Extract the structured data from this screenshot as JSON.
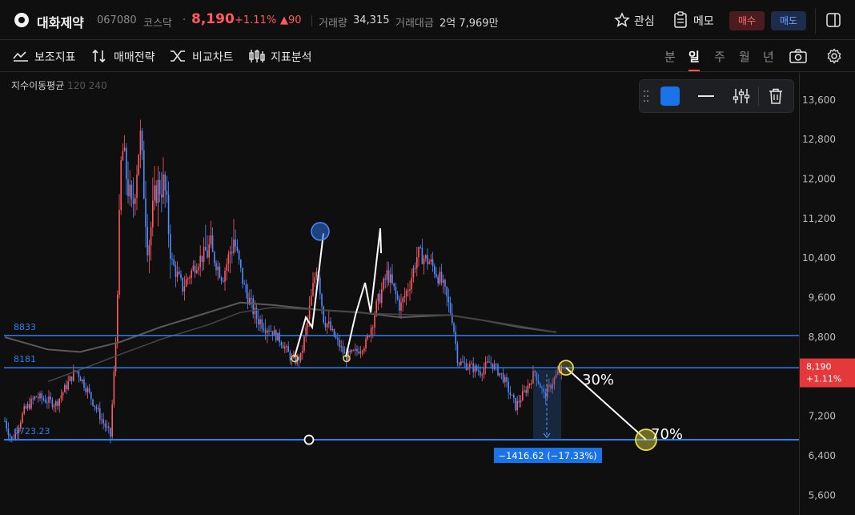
{
  "header": {
    "stock_name": "대화제약",
    "stock_code": "067080",
    "market": "코스닥",
    "separator": "·",
    "price": "8,190",
    "change_pct": "+1.11%",
    "change_amt": "▲90",
    "volume_label": "거래량",
    "volume_value": "34,315",
    "amount_label": "거래대금",
    "amount_value": "2억 7,969만",
    "favorite_label": "관심",
    "memo_label": "메모",
    "buy_label": "매수",
    "sell_label": "매도"
  },
  "toolbar": {
    "indicator_label": "보조지표",
    "strategy_label": "매매전략",
    "compare_label": "비교차트",
    "analysis_label": "지표분석",
    "periods": [
      "분",
      "일",
      "주",
      "월",
      "년"
    ],
    "active_period": "일"
  },
  "legend": {
    "label": "지수이동평균",
    "params": "120 240"
  },
  "colors": {
    "up": "#ff5a5f",
    "down": "#4e8cff",
    "accent": "#1a73e8",
    "line_blue": "#2f7fe8",
    "annotation_yellow": "#e6d94a"
  },
  "chart_data": {
    "type": "candlestick",
    "y_ticks": [
      "13,600",
      "12,800",
      "12,000",
      "11,200",
      "10,400",
      "9,600",
      "8,800",
      "8,000",
      "7,200",
      "6,400",
      "5,600"
    ],
    "ylim": [
      5200,
      14100
    ],
    "current_price_label": "8,190",
    "current_change_label": "+1.11%",
    "horizontal_lines": [
      {
        "label": "8833",
        "value": 8833
      },
      {
        "label": "8181",
        "value": 8181
      },
      {
        "label": "6723.23",
        "value": 6723.23
      }
    ],
    "annotations": {
      "measure_label": "−1416.62 (−17.33%)",
      "pct_30": "30%",
      "pct_70": "70%"
    }
  }
}
